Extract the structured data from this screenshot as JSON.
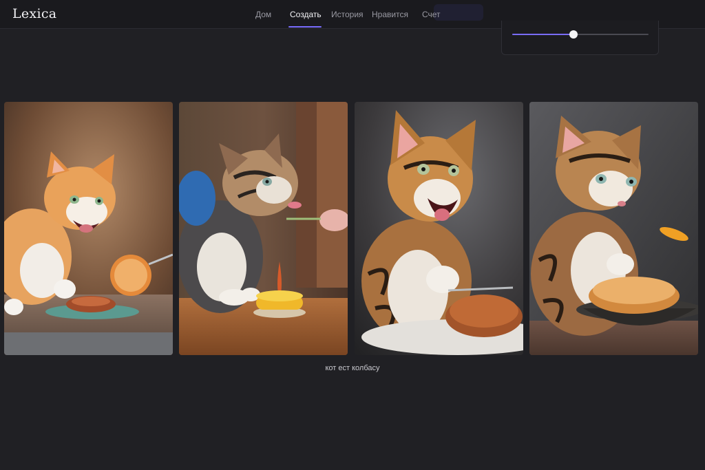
{
  "app": {
    "logo": "Lexica"
  },
  "nav": {
    "items": [
      {
        "label": "Дом",
        "active": false
      },
      {
        "label": "Создать",
        "active": true
      },
      {
        "label": "История",
        "active": false
      },
      {
        "label": "Нравится",
        "active": false
      },
      {
        "label": "Счет",
        "active": false
      }
    ]
  },
  "settings": {
    "slider_value": 0.45
  },
  "gallery": {
    "caption": "кот ест колбасу",
    "images": [
      {
        "icon": "cat-eating-image"
      },
      {
        "icon": "cat-eating-image"
      },
      {
        "icon": "cat-eating-image"
      },
      {
        "icon": "cat-eating-image"
      }
    ]
  },
  "colors": {
    "accent": "#7a6cff",
    "background": "#202024",
    "topbar": "#1a1a1e"
  }
}
